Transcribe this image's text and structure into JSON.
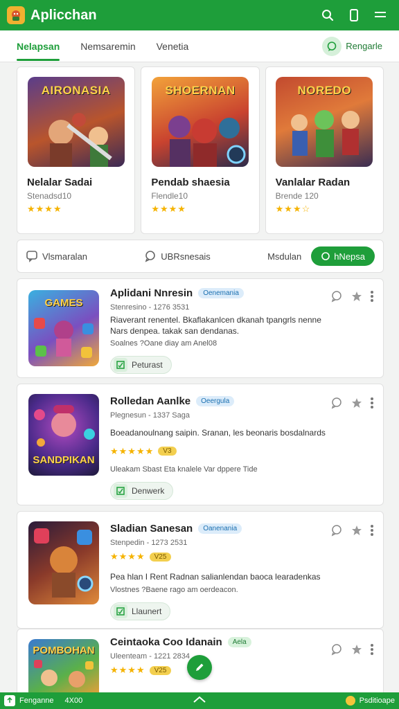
{
  "appbar": {
    "title": "Aplicchan",
    "accent": "#1e9e3a"
  },
  "tabs": {
    "items": [
      {
        "label": "Nelapsan",
        "active": true
      },
      {
        "label": "Nemsaremin",
        "active": false
      },
      {
        "label": "Venetia",
        "active": false
      }
    ],
    "action_label": "Rengarle"
  },
  "featured": [
    {
      "banner": "AIRONASIA",
      "name": "Nelalar Sadai",
      "meta": "Stenadsd10",
      "stars": "★★★★"
    },
    {
      "banner": "SHOERNAN",
      "name": "Pendab shaesia",
      "meta": "Flendle10",
      "stars": "★★★★"
    },
    {
      "banner": "NOREDO",
      "name": "Vanlalar Radan",
      "meta": "Brende 120",
      "stars": "★★★☆"
    }
  ],
  "filters": {
    "item1": "Vlsmaralan",
    "item2": "UBRsnesais",
    "item3": "Msdulan",
    "pill": "hNepsa"
  },
  "apps": [
    {
      "thumb_text": "GAMES",
      "title": "Aplidani Nnresin",
      "badge": "Oenemania",
      "meta": "Stenresino - 1276 3531",
      "desc": "Riaverant renentel. Bkaflakanlcen dkanah tpangrls nenne Nars denpea. takak san dendanas.",
      "info": "Soalnes ?Oane diay am Anel08",
      "tag": "Peturast"
    },
    {
      "thumb_text": "SANDPIKAN",
      "title": "Rolledan Aanlke",
      "badge": "Oeergula",
      "meta": "Plegnesun - 1337 Saga",
      "desc": "Boeadanoulnang saipin. Sranan, les beonaris bosdalnards",
      "stars": "★★★★★",
      "score": "V3",
      "info": "Uleakam Sbast Eta knalele Var dppere Tide",
      "tag": "Denwerk"
    },
    {
      "thumb_text": "",
      "title": "Sladian Sanesan",
      "badge": "Oanenania",
      "meta": "Stenpedin - 1273 2531",
      "stars": "★★★★",
      "score": "V25",
      "desc": "Pea hlan I Rent Radnan salianlendan baoca learadenkas",
      "info": "Vlostnes ?Baene rago am oerdeacon.",
      "tag": "Llaunert"
    },
    {
      "thumb_text": "POMBOHAN",
      "title": "Ceintaoka Coo Idanain",
      "badge": "Aela",
      "meta": "Uleenteam - 1221 2834",
      "stars": "★★★★",
      "score": "V25"
    }
  ],
  "bottombar": {
    "left_label": "Fenganne",
    "left_value": "4X00",
    "right_label": "Psditioape"
  }
}
